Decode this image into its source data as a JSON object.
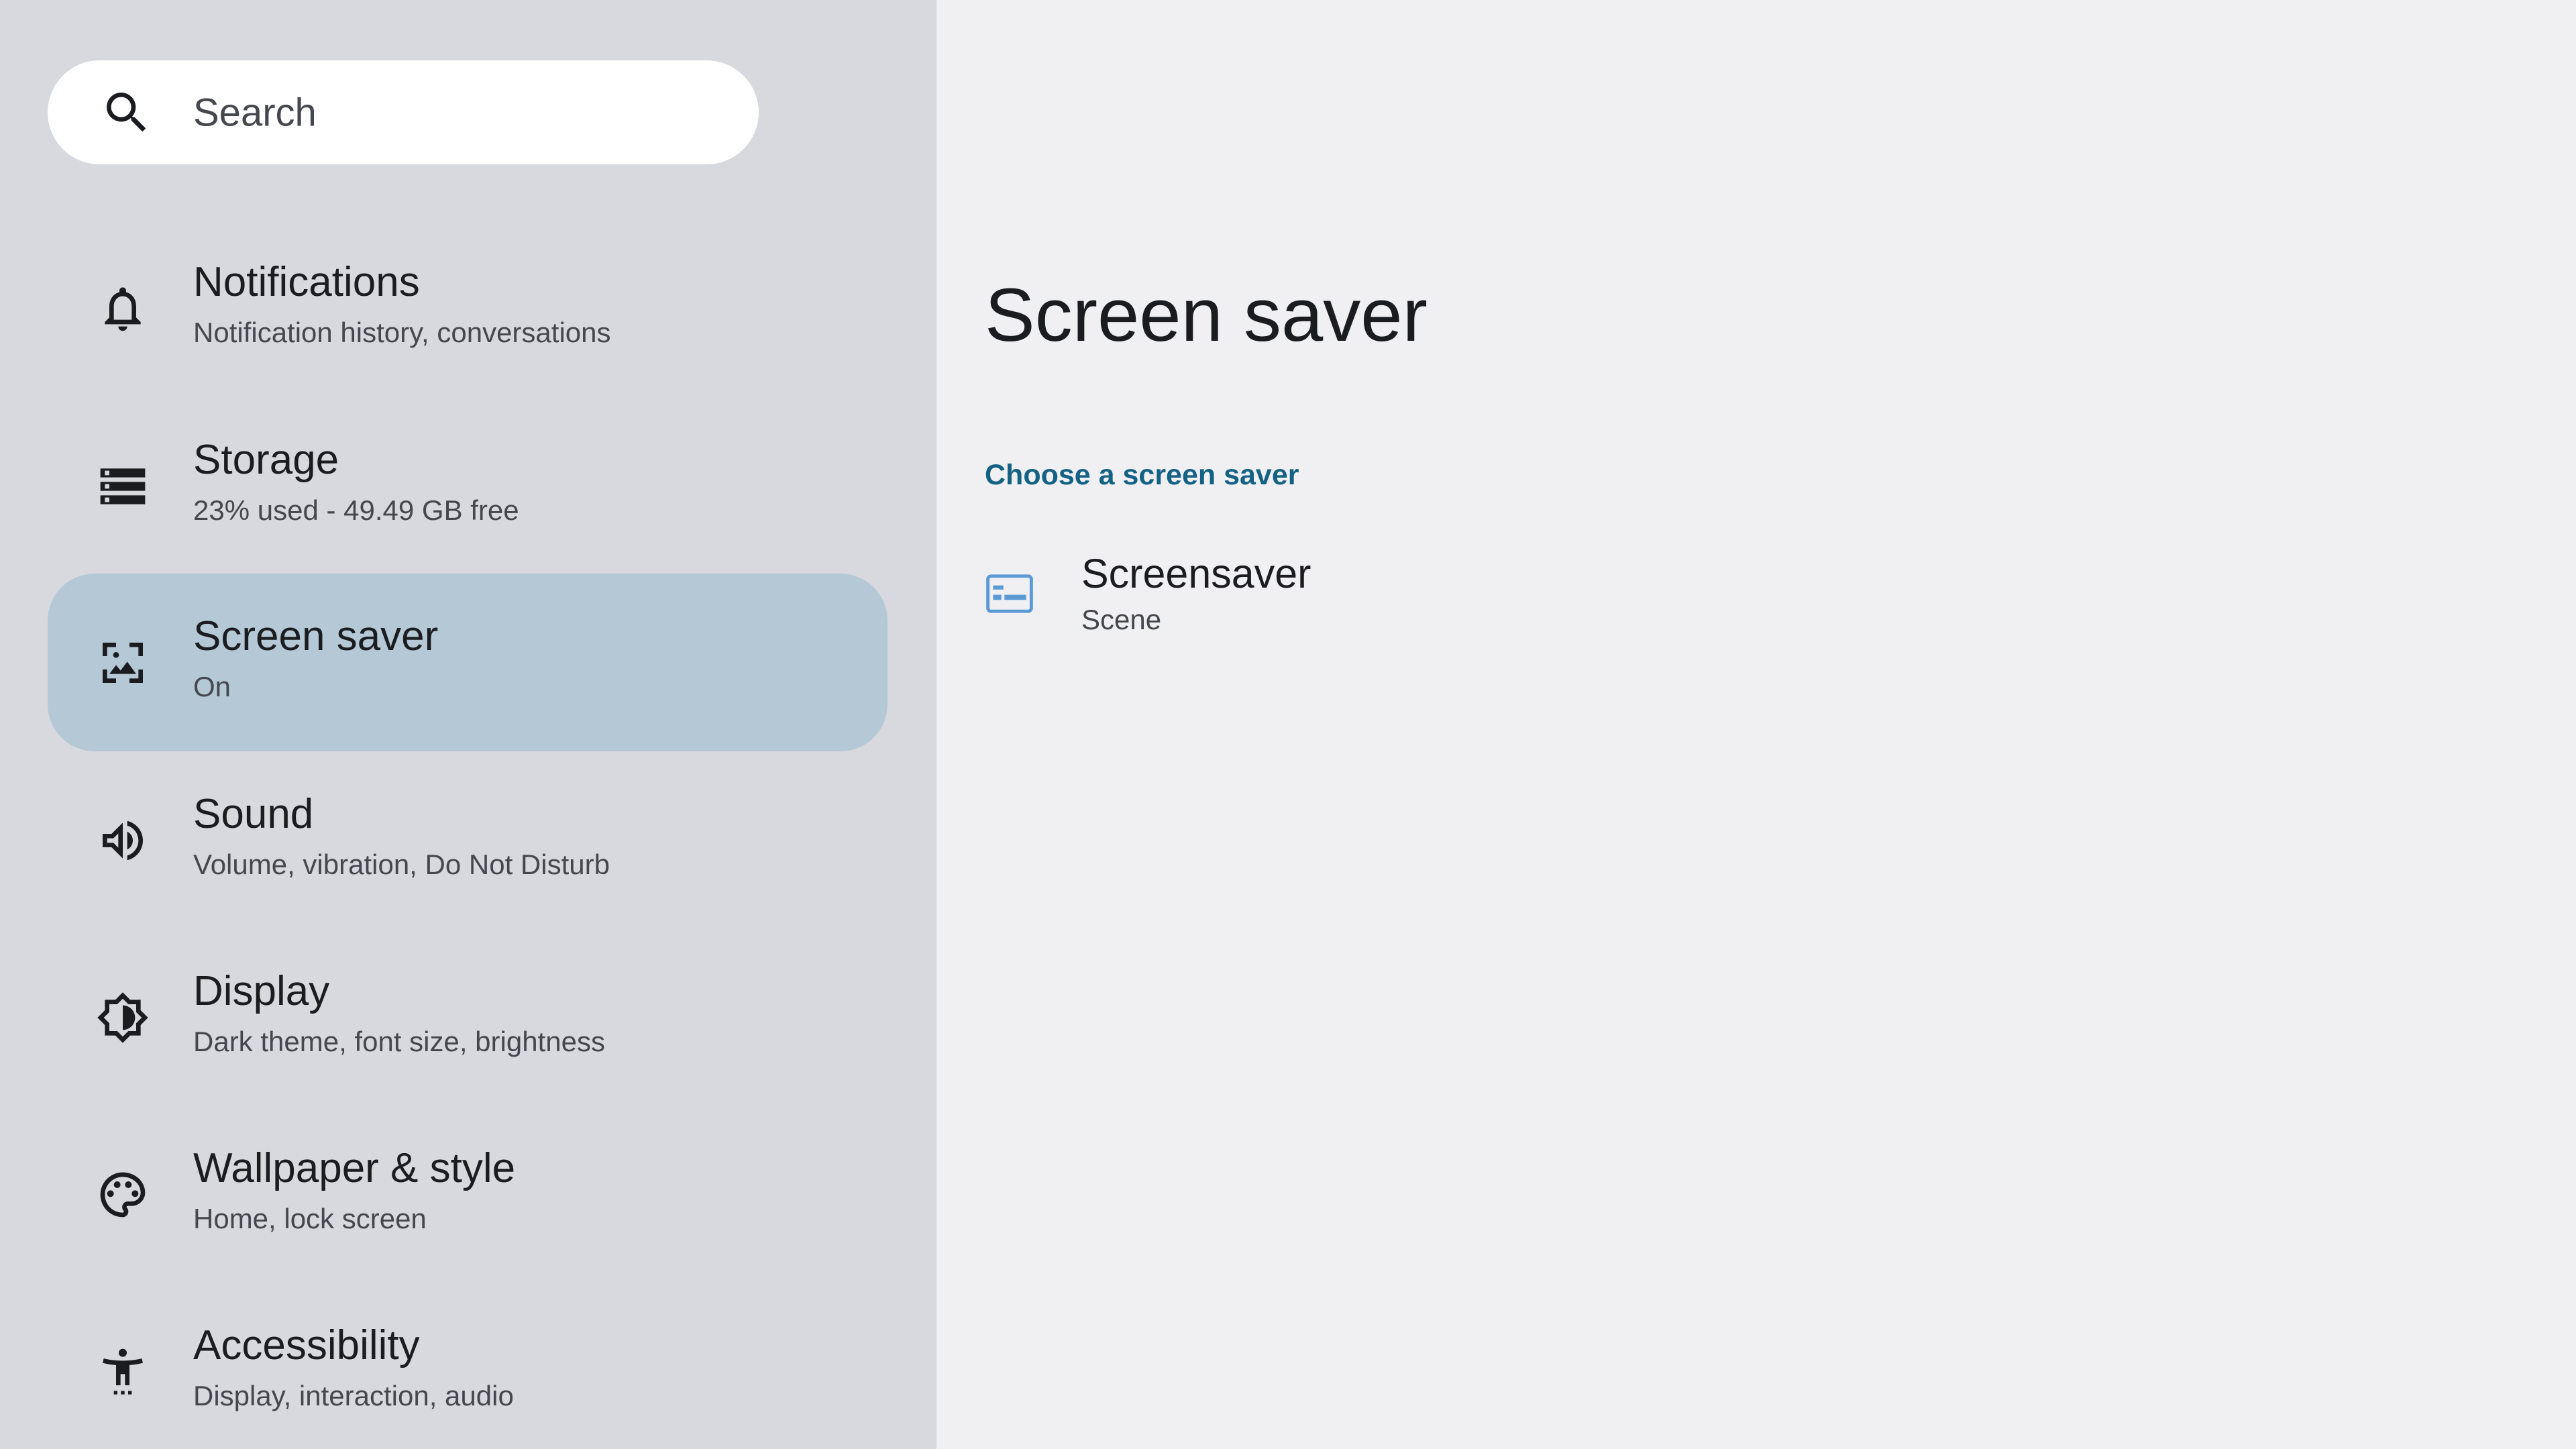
{
  "search": {
    "placeholder": "Search",
    "icon": "search-icon"
  },
  "sidebar": {
    "items": [
      {
        "title": "Notifications",
        "subtitle": "Notification history, conversations",
        "icon": "bell-icon",
        "active": false
      },
      {
        "title": "Storage",
        "subtitle": "23% used - 49.49 GB free",
        "icon": "storage-icon",
        "active": false
      },
      {
        "title": "Screen saver",
        "subtitle": "On",
        "icon": "screensaver-icon",
        "active": true
      },
      {
        "title": "Sound",
        "subtitle": "Volume, vibration, Do Not Disturb",
        "icon": "volume-icon",
        "active": false
      },
      {
        "title": "Display",
        "subtitle": "Dark theme, font size, brightness",
        "icon": "brightness-icon",
        "active": false
      },
      {
        "title": "Wallpaper & style",
        "subtitle": "Home, lock screen",
        "icon": "palette-icon",
        "active": false
      },
      {
        "title": "Accessibility",
        "subtitle": "Display, interaction, audio",
        "icon": "accessibility-icon",
        "active": false
      }
    ]
  },
  "main": {
    "title": "Screen saver",
    "section_header": "Choose a screen saver",
    "options": [
      {
        "title": "Screensaver",
        "subtitle": "Scene",
        "icon": "screensaver-app-icon"
      }
    ]
  },
  "colors": {
    "sidebar_bg": "#d8d9de",
    "main_bg": "#f0f0f3",
    "active_item_bg": "#b4c8d6",
    "accent": "#136183",
    "icon_blue": "#5b9bd5"
  }
}
